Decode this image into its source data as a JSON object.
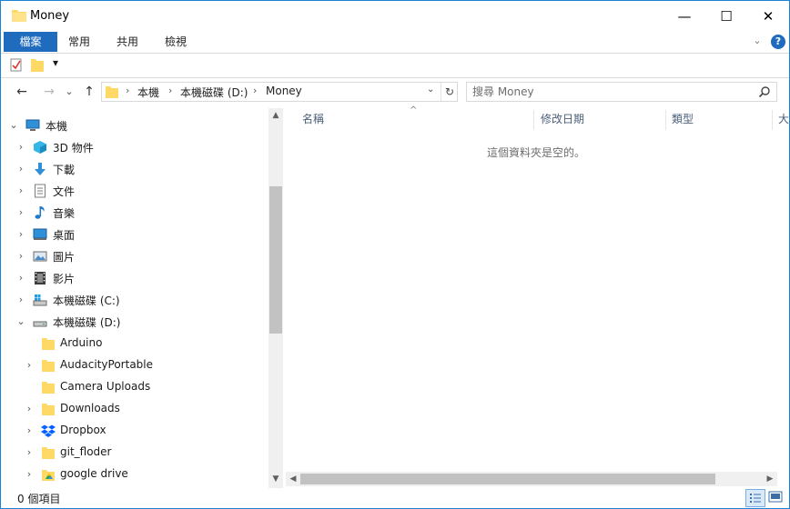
{
  "window": {
    "title": "Money",
    "min_glyph": "—",
    "max_glyph": "☐",
    "close_glyph": "✕"
  },
  "ribbon": {
    "tabs": [
      {
        "label": "檔案",
        "active": true
      },
      {
        "label": "常用"
      },
      {
        "label": "共用"
      },
      {
        "label": "檢視"
      }
    ],
    "collapse_icon": "chevron-down-icon",
    "help_label": "?"
  },
  "quick_access": {
    "items": [
      "properties-icon",
      "new-folder-icon",
      "customize-dropdown-icon"
    ],
    "customize_glyph": "▾"
  },
  "nav": {
    "back_glyph": "←",
    "forward_glyph": "→",
    "recent_glyph": "⌄",
    "up_glyph": "↑",
    "breadcrumb": [
      "本機",
      "本機磁碟 (D:)",
      "Money"
    ],
    "separator": "›",
    "dropdown_glyph": "⌄",
    "refresh_glyph": "↻"
  },
  "search": {
    "placeholder": "搜尋 Money"
  },
  "tree": {
    "items": [
      {
        "label": "本機",
        "icon": "computer-icon",
        "state": "expanded",
        "level": 0
      },
      {
        "label": "3D 物件",
        "icon": "3d-objects-icon",
        "state": "collapsed",
        "level": 1
      },
      {
        "label": "下載",
        "icon": "downloads-icon",
        "state": "collapsed",
        "level": 1
      },
      {
        "label": "文件",
        "icon": "documents-icon",
        "state": "collapsed",
        "level": 1
      },
      {
        "label": "音樂",
        "icon": "music-icon",
        "state": "collapsed",
        "level": 1
      },
      {
        "label": "桌面",
        "icon": "desktop-icon",
        "state": "collapsed",
        "level": 1
      },
      {
        "label": "圖片",
        "icon": "pictures-icon",
        "state": "collapsed",
        "level": 1
      },
      {
        "label": "影片",
        "icon": "videos-icon",
        "state": "collapsed",
        "level": 1
      },
      {
        "label": "本機磁碟 (C:)",
        "icon": "windows-drive-icon",
        "state": "collapsed",
        "level": 1
      },
      {
        "label": "本機磁碟 (D:)",
        "icon": "drive-icon",
        "state": "expanded",
        "level": 1
      },
      {
        "label": "Arduino",
        "icon": "folder-icon",
        "state": "none",
        "level": 2
      },
      {
        "label": "AudacityPortable",
        "icon": "folder-icon",
        "state": "collapsed",
        "level": 2
      },
      {
        "label": "Camera Uploads",
        "icon": "folder-icon",
        "state": "none",
        "level": 2
      },
      {
        "label": "Downloads",
        "icon": "folder-icon",
        "state": "collapsed",
        "level": 2
      },
      {
        "label": "Dropbox",
        "icon": "dropbox-icon",
        "state": "collapsed",
        "level": 2
      },
      {
        "label": "git_floder",
        "icon": "folder-icon",
        "state": "collapsed",
        "level": 2
      },
      {
        "label": "google drive",
        "icon": "google-drive-folder-icon",
        "state": "collapsed",
        "level": 2
      }
    ]
  },
  "content": {
    "columns": [
      "名稱",
      "修改日期",
      "類型",
      "大"
    ],
    "empty_message": "這個資料夾是空的。"
  },
  "status": {
    "item_count": "0 個項目"
  },
  "colors": {
    "accent": "#1f6cbf",
    "folder": "#ffd966",
    "window_border": "#1883d7"
  }
}
